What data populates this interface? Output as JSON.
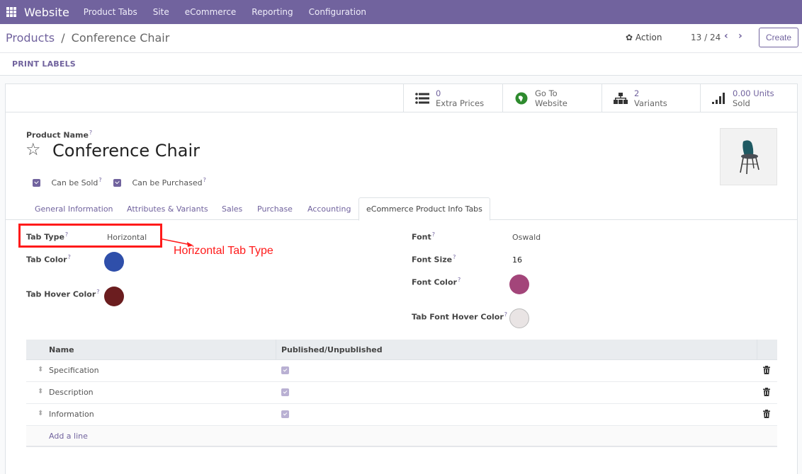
{
  "topbar": {
    "app_name": "Website",
    "menu": [
      "Product Tabs",
      "Site",
      "eCommerce",
      "Reporting",
      "Configuration"
    ]
  },
  "control_panel": {
    "breadcrumb_parent": "Products",
    "breadcrumb_separator": "/",
    "breadcrumb_current": "Conference Chair",
    "action_label": "Action",
    "pager": "13 / 24",
    "create_label": "Create",
    "print_labels": "PRINT LABELS"
  },
  "smart_buttons": [
    {
      "value": "0",
      "label": "Extra Prices",
      "icon": "list-icon"
    },
    {
      "value": "Go To",
      "label": "Website",
      "icon": "globe-icon"
    },
    {
      "value": "2",
      "label": "Variants",
      "icon": "sitemap-icon"
    },
    {
      "value": "0.00 Units",
      "label": "Sold",
      "icon": "signal-icon"
    }
  ],
  "product": {
    "name_label": "Product Name",
    "name": "Conference Chair",
    "can_be_sold_label": "Can be Sold",
    "can_be_purchased_label": "Can be Purchased",
    "help_mark": "?"
  },
  "tabs": [
    "General Information",
    "Attributes & Variants",
    "Sales",
    "Purchase",
    "Accounting",
    "eCommerce Product Info Tabs"
  ],
  "active_tab": "eCommerce Product Info Tabs",
  "fields": {
    "tab_type_label": "Tab Type",
    "tab_type": "Horizontal",
    "tab_color_label": "Tab Color",
    "tab_color": "#2f4faa",
    "tab_hover_color_label": "Tab Hover Color",
    "tab_hover_color": "#6b1d1f",
    "font_label": "Font",
    "font": "Oswald",
    "font_size_label": "Font Size",
    "font_size": "16",
    "font_color_label": "Font Color",
    "font_color": "#a3457a",
    "tab_font_hover_color_label": "Tab Font Hover Color",
    "tab_font_hover_color": "#e9e4e4"
  },
  "annotation": {
    "text": "Horizontal Tab Type",
    "color": "#ff1a1a"
  },
  "table": {
    "headers": [
      "Name",
      "Published/Unpublished"
    ],
    "rows": [
      {
        "name": "Specification",
        "published": true
      },
      {
        "name": "Description",
        "published": true
      },
      {
        "name": "Information",
        "published": true
      }
    ],
    "add_line": "Add a line"
  },
  "colors": {
    "brand": "#71639e"
  }
}
